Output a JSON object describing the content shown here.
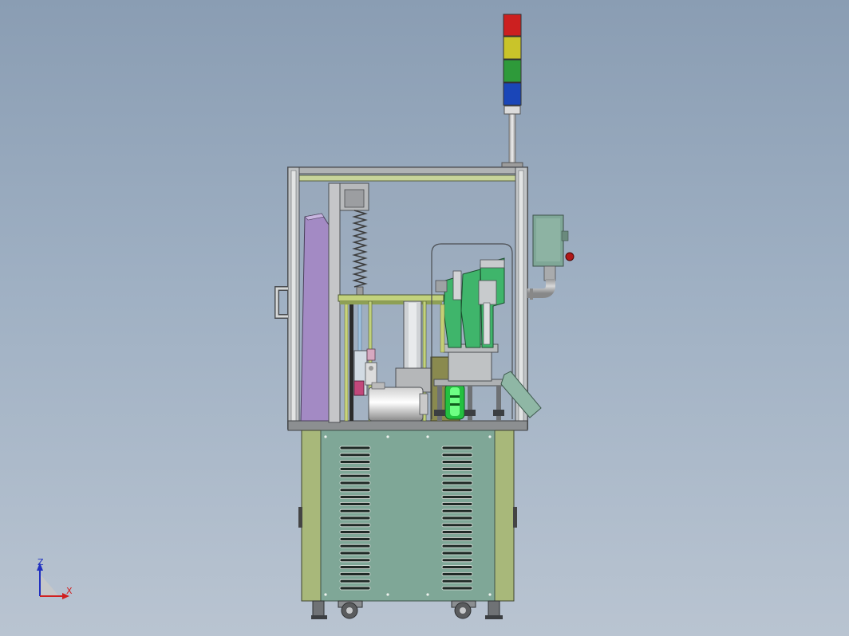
{
  "viewport": {
    "background_top": "#8a9db3",
    "background_bottom": "#b9c4d1"
  },
  "triad": {
    "z_label": "Z",
    "x_label": "X",
    "z_color": "#2030c0",
    "x_color": "#d02020"
  },
  "model": {
    "frame_color": "#6c6f73",
    "cabinet_side_color": "#a8b87a",
    "cabinet_front_color": "#7fa797",
    "accent_green": "#3fb56b",
    "accent_purple": "#a38ac4"
  },
  "stack_light": {
    "segments": [
      "#cc2020",
      "#c9c42a",
      "#2e9a3a",
      "#1a46b8"
    ]
  }
}
